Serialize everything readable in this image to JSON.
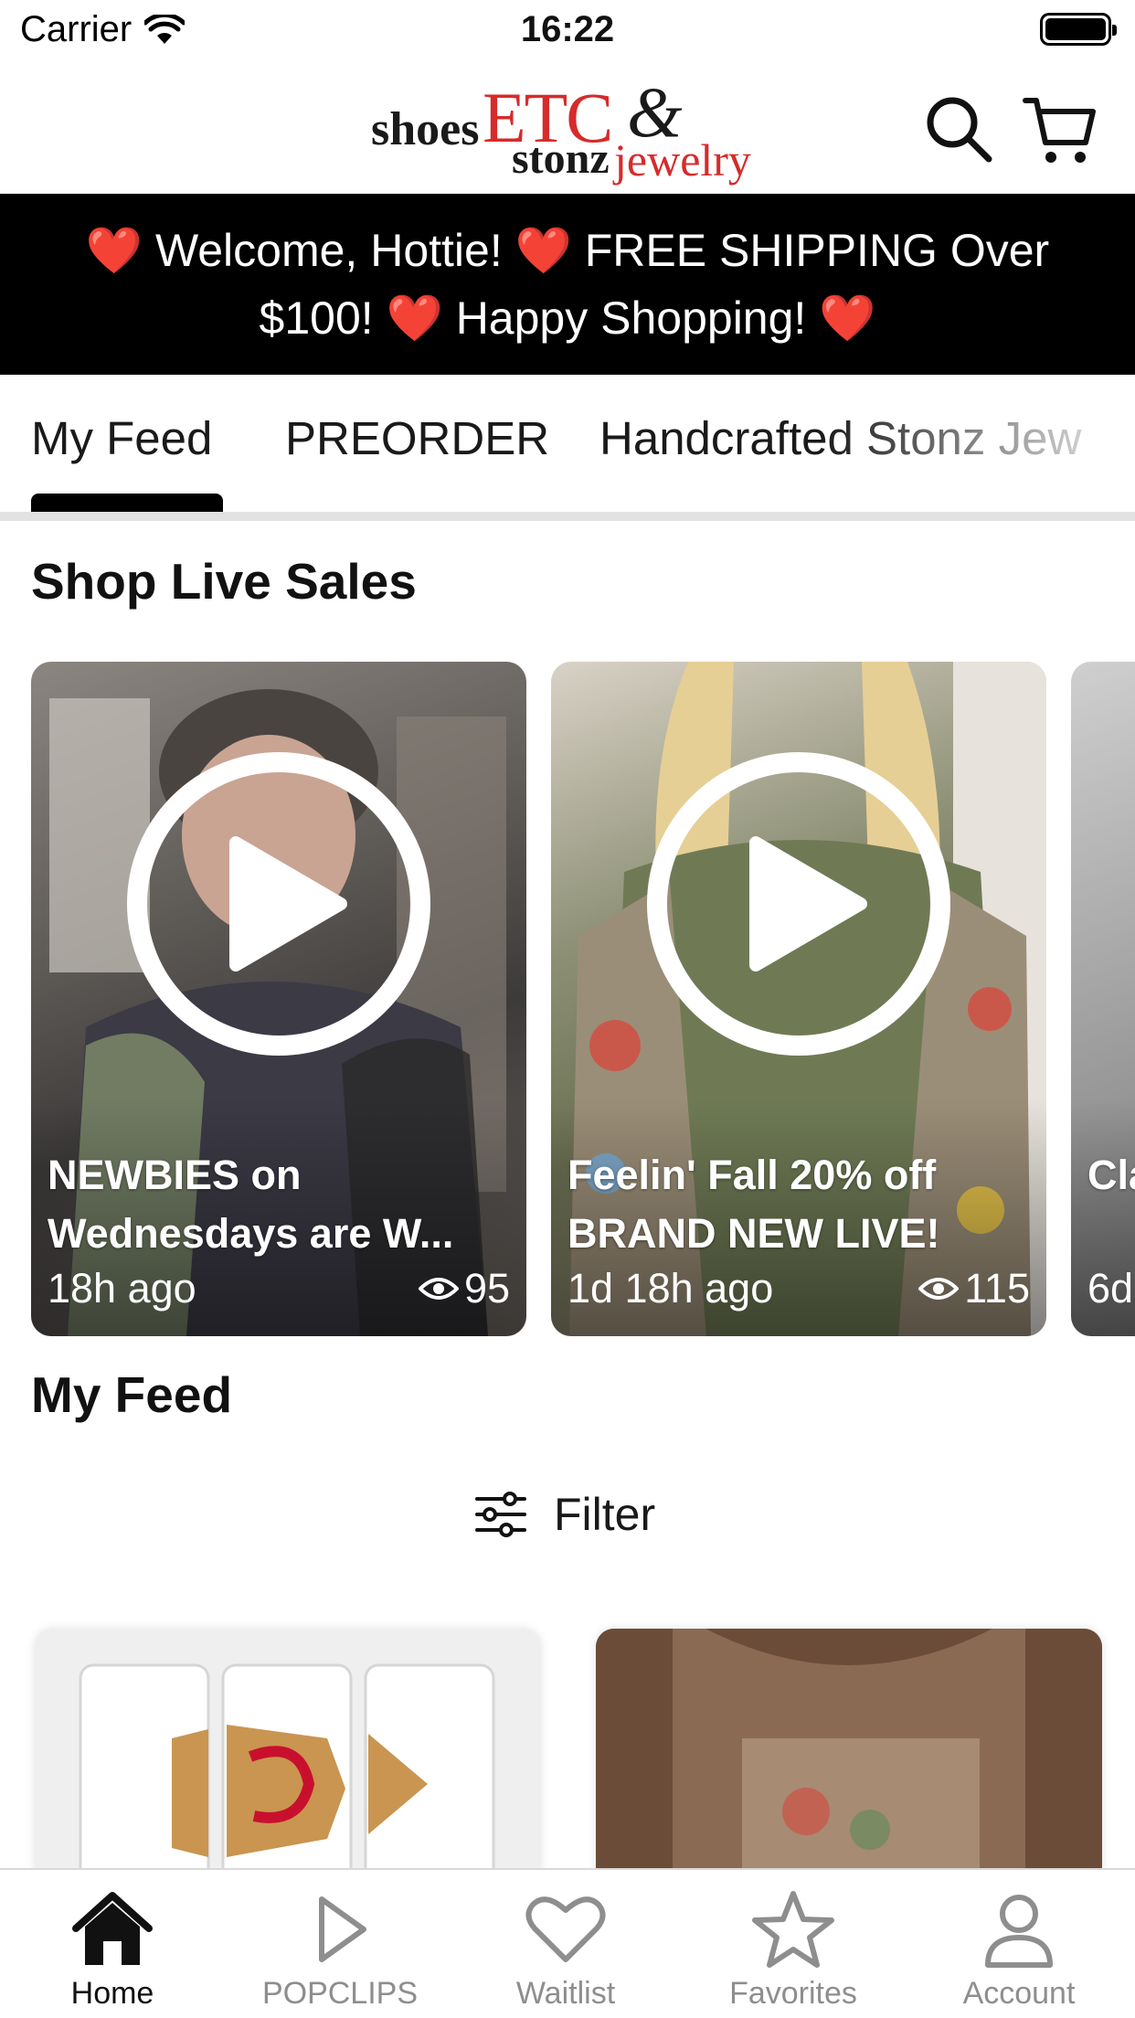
{
  "status_bar": {
    "carrier": "Carrier",
    "time": "16:22"
  },
  "header": {
    "logo": {
      "shoes": "shoes",
      "etc": "ETC",
      "amp": "&",
      "stonz": "stonz",
      "jewelry": "jewelry"
    },
    "search_icon": "search-icon",
    "cart_icon": "cart-icon"
  },
  "banner": {
    "text": "❤️ Welcome, Hottie! ❤️ FREE SHIPPING Over $100! ❤️ Happy Shopping! ❤️"
  },
  "tabs": [
    {
      "label": "My Feed",
      "active": true
    },
    {
      "label": "PREORDER",
      "active": false
    },
    {
      "label": "Handcrafted Stonz Jew",
      "active": false
    }
  ],
  "live_sales": {
    "title": "Shop Live Sales",
    "cards": [
      {
        "title": "NEWBIES on Wednesdays are W...",
        "time": "18h ago",
        "views": "95"
      },
      {
        "title": "Feelin' Fall 20% off BRAND NEW LIVE!",
        "time": "1d 18h ago",
        "views": "115"
      },
      {
        "title": "Cla Co",
        "time": "6d",
        "views": ""
      }
    ]
  },
  "feed": {
    "title": "My Feed",
    "filter_label": "Filter"
  },
  "bottom_nav": [
    {
      "label": "Home",
      "icon": "home-icon",
      "active": true
    },
    {
      "label": "POPCLIPS",
      "icon": "play-icon",
      "active": false
    },
    {
      "label": "Waitlist",
      "icon": "heart-icon",
      "active": false
    },
    {
      "label": "Favorites",
      "icon": "star-icon",
      "active": false
    },
    {
      "label": "Account",
      "icon": "person-icon",
      "active": false
    }
  ],
  "colors": {
    "brand_red": "#d62b2b",
    "banner_bg": "#000000",
    "inactive_nav": "#8e8e8e"
  }
}
